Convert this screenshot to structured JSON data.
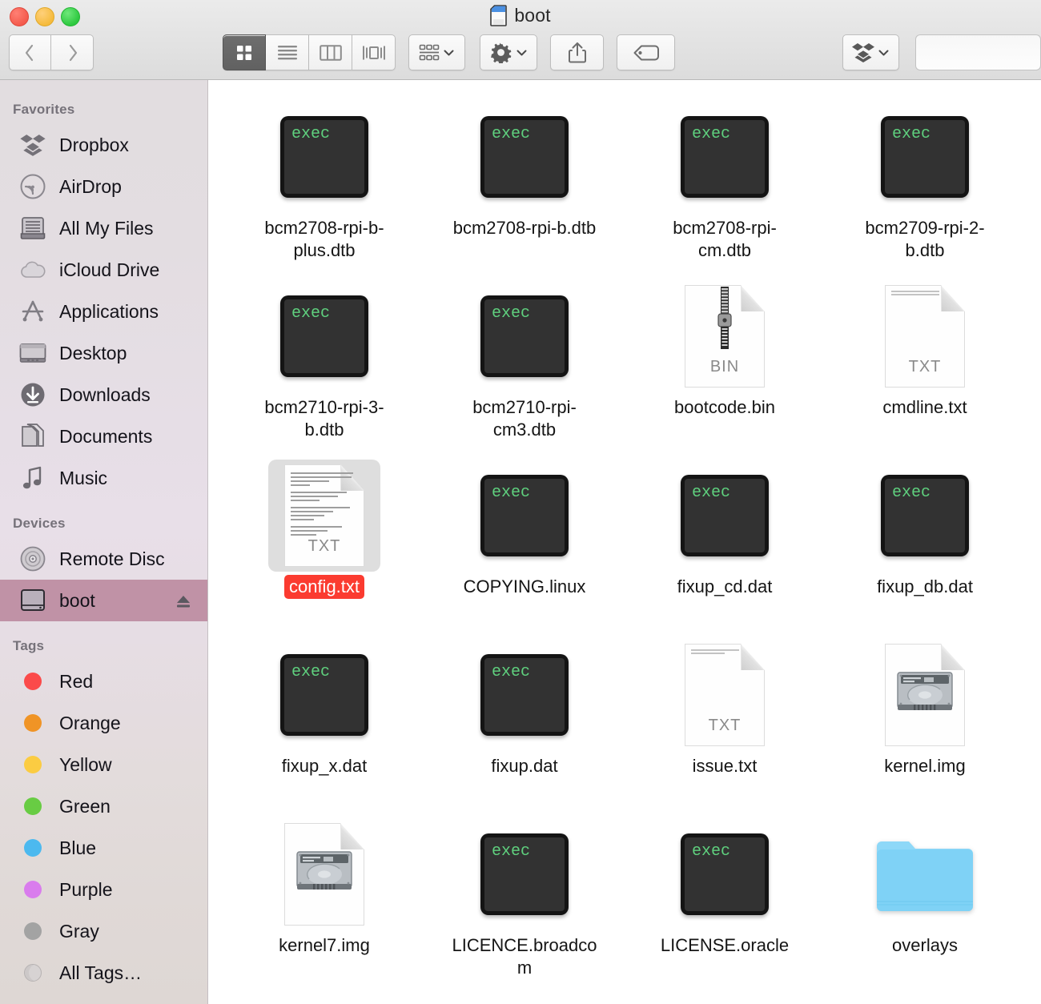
{
  "window": {
    "title": "boot",
    "title_icon": "sd-card-icon",
    "traffic_lights": [
      {
        "name": "close",
        "color": "#f45b4d"
      },
      {
        "name": "minimize",
        "color": "#f5bb3d"
      },
      {
        "name": "zoom",
        "color": "#2ec940"
      }
    ]
  },
  "toolbar": {
    "back_label": "Back",
    "forward_label": "Forward",
    "view_modes": [
      {
        "name": "icon-view",
        "label": "Icon View",
        "active": true
      },
      {
        "name": "list-view",
        "label": "List View",
        "active": false
      },
      {
        "name": "column-view",
        "label": "Column View",
        "active": false
      },
      {
        "name": "coverflow-view",
        "label": "Cover Flow View",
        "active": false
      }
    ],
    "arrange_label": "Arrange",
    "action_label": "Action",
    "share_label": "Share",
    "tags_label": "Edit Tags",
    "dropbox_label": "Dropbox",
    "search_value": "",
    "search_placeholder": ""
  },
  "sidebar": {
    "sections": [
      {
        "title": "Favorites",
        "items": [
          {
            "label": "Dropbox",
            "icon": "dropbox-icon",
            "selected": false
          },
          {
            "label": "AirDrop",
            "icon": "airdrop-icon",
            "selected": false
          },
          {
            "label": "All My Files",
            "icon": "all-my-files-icon",
            "selected": false
          },
          {
            "label": "iCloud Drive",
            "icon": "icloud-icon",
            "selected": false
          },
          {
            "label": "Applications",
            "icon": "applications-icon",
            "selected": false
          },
          {
            "label": "Desktop",
            "icon": "desktop-icon",
            "selected": false
          },
          {
            "label": "Downloads",
            "icon": "downloads-icon",
            "selected": false
          },
          {
            "label": "Documents",
            "icon": "documents-icon",
            "selected": false
          },
          {
            "label": "Music",
            "icon": "music-icon",
            "selected": false
          }
        ]
      },
      {
        "title": "Devices",
        "items": [
          {
            "label": "Remote Disc",
            "icon": "optical-disc-icon",
            "selected": false
          },
          {
            "label": "boot",
            "icon": "external-drive-icon",
            "selected": true,
            "eject": true
          }
        ]
      },
      {
        "title": "Tags",
        "items": [
          {
            "label": "Red",
            "icon": "tag-dot-icon",
            "color": "#fb4a4a",
            "selected": false
          },
          {
            "label": "Orange",
            "icon": "tag-dot-icon",
            "color": "#f09426",
            "selected": false
          },
          {
            "label": "Yellow",
            "icon": "tag-dot-icon",
            "color": "#fbcc42",
            "selected": false
          },
          {
            "label": "Green",
            "icon": "tag-dot-icon",
            "color": "#68cc43",
            "selected": false
          },
          {
            "label": "Blue",
            "icon": "tag-dot-icon",
            "color": "#4cb9ef",
            "selected": false
          },
          {
            "label": "Purple",
            "icon": "tag-dot-icon",
            "color": "#d97ced",
            "selected": false
          },
          {
            "label": "Gray",
            "icon": "tag-dot-icon",
            "color": "#a3a3a3",
            "selected": false
          },
          {
            "label": "All Tags…",
            "icon": "all-tags-icon",
            "color": "#d7d3d3",
            "selected": false
          }
        ]
      }
    ],
    "selection_color": "#c092a6"
  },
  "content": {
    "selection_label_color": "#fb3b30",
    "files": [
      {
        "name": "bcm2708-rpi-b-plus.dtb",
        "icon": "exec-icon",
        "badge": "exec",
        "selected": false
      },
      {
        "name": "bcm2708-rpi-b.dtb",
        "icon": "exec-icon",
        "badge": "exec",
        "selected": false
      },
      {
        "name": "bcm2708-rpi-cm.dtb",
        "icon": "exec-icon",
        "badge": "exec",
        "selected": false
      },
      {
        "name": "bcm2709-rpi-2-b.dtb",
        "icon": "exec-icon",
        "badge": "exec",
        "selected": false
      },
      {
        "name": "bcm2710-rpi-3-b.dtb",
        "icon": "exec-icon",
        "badge": "exec",
        "selected": false
      },
      {
        "name": "bcm2710-rpi-cm3.dtb",
        "icon": "exec-icon",
        "badge": "exec",
        "selected": false
      },
      {
        "name": "bootcode.bin",
        "icon": "bin-document-icon",
        "badge": "BIN",
        "selected": false
      },
      {
        "name": "cmdline.txt",
        "icon": "txt-document-icon",
        "badge": "TXT",
        "selected": false
      },
      {
        "name": "config.txt",
        "icon": "txt-document-preview-icon",
        "badge": "TXT",
        "selected": true
      },
      {
        "name": "COPYING.linux",
        "icon": "exec-icon",
        "badge": "exec",
        "selected": false
      },
      {
        "name": "fixup_cd.dat",
        "icon": "exec-icon",
        "badge": "exec",
        "selected": false
      },
      {
        "name": "fixup_db.dat",
        "icon": "exec-icon",
        "badge": "exec",
        "selected": false
      },
      {
        "name": "fixup_x.dat",
        "icon": "exec-icon",
        "badge": "exec",
        "selected": false
      },
      {
        "name": "fixup.dat",
        "icon": "exec-icon",
        "badge": "exec",
        "selected": false
      },
      {
        "name": "issue.txt",
        "icon": "txt-document-icon",
        "badge": "TXT",
        "selected": false
      },
      {
        "name": "kernel.img",
        "icon": "disk-image-icon",
        "badge": "",
        "selected": false
      },
      {
        "name": "kernel7.img",
        "icon": "disk-image-icon",
        "badge": "",
        "selected": false
      },
      {
        "name": "LICENCE.broadcom",
        "icon": "exec-icon",
        "badge": "exec",
        "selected": false
      },
      {
        "name": "LICENSE.oracle",
        "icon": "exec-icon",
        "badge": "exec",
        "selected": false
      },
      {
        "name": "overlays",
        "icon": "folder-icon",
        "badge": "",
        "selected": false
      }
    ]
  }
}
